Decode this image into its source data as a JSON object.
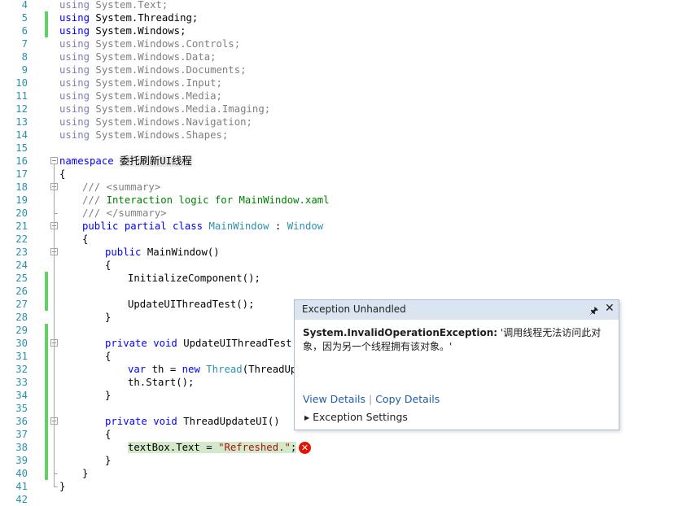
{
  "editor": {
    "lines": [
      {
        "no": "4",
        "changed": false,
        "fold": "",
        "indent": 0,
        "tokens": [
          {
            "t": "using",
            "c": "kwd"
          },
          {
            "t": " System.Text;",
            "c": "txd"
          }
        ]
      },
      {
        "no": "5",
        "changed": true,
        "fold": "",
        "indent": 0,
        "tokens": [
          {
            "t": "using",
            "c": "kw"
          },
          {
            "t": " System.Threading;",
            "c": "tx"
          }
        ]
      },
      {
        "no": "6",
        "changed": true,
        "fold": "",
        "indent": 0,
        "tokens": [
          {
            "t": "using",
            "c": "kw"
          },
          {
            "t": " System.Windows;",
            "c": "tx"
          }
        ]
      },
      {
        "no": "7",
        "changed": false,
        "fold": "",
        "indent": 0,
        "tokens": [
          {
            "t": "using",
            "c": "kwd"
          },
          {
            "t": " System.Windows.Controls;",
            "c": "txd"
          }
        ]
      },
      {
        "no": "8",
        "changed": false,
        "fold": "",
        "indent": 0,
        "tokens": [
          {
            "t": "using",
            "c": "kwd"
          },
          {
            "t": " System.Windows.Data;",
            "c": "txd"
          }
        ]
      },
      {
        "no": "9",
        "changed": false,
        "fold": "",
        "indent": 0,
        "tokens": [
          {
            "t": "using",
            "c": "kwd"
          },
          {
            "t": " System.Windows.Documents;",
            "c": "txd"
          }
        ]
      },
      {
        "no": "10",
        "changed": false,
        "fold": "",
        "indent": 0,
        "tokens": [
          {
            "t": "using",
            "c": "kwd"
          },
          {
            "t": " System.Windows.Input;",
            "c": "txd"
          }
        ]
      },
      {
        "no": "11",
        "changed": false,
        "fold": "",
        "indent": 0,
        "tokens": [
          {
            "t": "using",
            "c": "kwd"
          },
          {
            "t": " System.Windows.Media;",
            "c": "txd"
          }
        ]
      },
      {
        "no": "12",
        "changed": false,
        "fold": "",
        "indent": 0,
        "tokens": [
          {
            "t": "using",
            "c": "kwd"
          },
          {
            "t": " System.Windows.Media.Imaging;",
            "c": "txd"
          }
        ]
      },
      {
        "no": "13",
        "changed": false,
        "fold": "",
        "indent": 0,
        "tokens": [
          {
            "t": "using",
            "c": "kwd"
          },
          {
            "t": " System.Windows.Navigation;",
            "c": "txd"
          }
        ]
      },
      {
        "no": "14",
        "changed": false,
        "fold": "",
        "indent": 0,
        "tokens": [
          {
            "t": "using",
            "c": "kwd"
          },
          {
            "t": " System.Windows.Shapes;",
            "c": "txd"
          }
        ]
      },
      {
        "no": "15",
        "changed": false,
        "fold": "",
        "indent": 0,
        "tokens": []
      },
      {
        "no": "16",
        "changed": false,
        "fold": "minus",
        "indent": 0,
        "tokens": [
          {
            "t": "namespace",
            "c": "kw"
          },
          {
            "t": " ",
            "c": "tx"
          },
          {
            "t": "委托刷新UI线程",
            "c": "tx hl-ns"
          }
        ]
      },
      {
        "no": "17",
        "changed": false,
        "fold": "",
        "indent": 0,
        "tokens": [
          {
            "t": "{",
            "c": "tx"
          }
        ]
      },
      {
        "no": "18",
        "changed": false,
        "fold": "minus",
        "indent": 1,
        "tokens": [
          {
            "t": "/// <summary>",
            "c": "cmg"
          }
        ]
      },
      {
        "no": "19",
        "changed": false,
        "fold": "",
        "indent": 1,
        "tokens": [
          {
            "t": "/// ",
            "c": "cmg"
          },
          {
            "t": "Interaction logic for MainWindow.xaml",
            "c": "cm"
          }
        ]
      },
      {
        "no": "20",
        "changed": false,
        "fold": "",
        "indent": 1,
        "tokens": [
          {
            "t": "/// </summary>",
            "c": "cmg"
          }
        ]
      },
      {
        "no": "21",
        "changed": false,
        "fold": "minus",
        "indent": 1,
        "tokens": [
          {
            "t": "public partial class ",
            "c": "kw"
          },
          {
            "t": "MainWindow",
            "c": "ty"
          },
          {
            "t": " : ",
            "c": "tx"
          },
          {
            "t": "Window",
            "c": "ty"
          }
        ]
      },
      {
        "no": "22",
        "changed": false,
        "fold": "",
        "indent": 1,
        "tokens": [
          {
            "t": "{",
            "c": "tx"
          }
        ]
      },
      {
        "no": "23",
        "changed": false,
        "fold": "minus",
        "indent": 2,
        "tokens": [
          {
            "t": "public",
            "c": "kw"
          },
          {
            "t": " MainWindow()",
            "c": "tx"
          }
        ]
      },
      {
        "no": "24",
        "changed": false,
        "fold": "",
        "indent": 2,
        "tokens": [
          {
            "t": "{",
            "c": "tx"
          }
        ]
      },
      {
        "no": "25",
        "changed": true,
        "fold": "",
        "indent": 3,
        "tokens": [
          {
            "t": "InitializeComponent();",
            "c": "tx"
          }
        ]
      },
      {
        "no": "26",
        "changed": true,
        "fold": "",
        "indent": 3,
        "tokens": []
      },
      {
        "no": "27",
        "changed": true,
        "fold": "",
        "indent": 3,
        "tokens": [
          {
            "t": "UpdateUIThreadTest();",
            "c": "tx"
          }
        ]
      },
      {
        "no": "28",
        "changed": false,
        "fold": "",
        "indent": 2,
        "tokens": [
          {
            "t": "}",
            "c": "tx"
          }
        ]
      },
      {
        "no": "29",
        "changed": true,
        "fold": "",
        "indent": 2,
        "tokens": []
      },
      {
        "no": "30",
        "changed": true,
        "fold": "minus",
        "indent": 2,
        "tokens": [
          {
            "t": "private void",
            "c": "kw"
          },
          {
            "t": " UpdateUIThreadTest()",
            "c": "tx"
          }
        ]
      },
      {
        "no": "31",
        "changed": true,
        "fold": "",
        "indent": 2,
        "tokens": [
          {
            "t": "{",
            "c": "tx"
          }
        ]
      },
      {
        "no": "32",
        "changed": true,
        "fold": "",
        "indent": 3,
        "tokens": [
          {
            "t": "var",
            "c": "kw"
          },
          {
            "t": " th = ",
            "c": "tx"
          },
          {
            "t": "new",
            "c": "kw"
          },
          {
            "t": " ",
            "c": "tx"
          },
          {
            "t": "Thread",
            "c": "ty"
          },
          {
            "t": "(ThreadUpd",
            "c": "tx"
          }
        ]
      },
      {
        "no": "33",
        "changed": true,
        "fold": "",
        "indent": 3,
        "tokens": [
          {
            "t": "th.Start();",
            "c": "tx"
          }
        ]
      },
      {
        "no": "34",
        "changed": true,
        "fold": "",
        "indent": 2,
        "tokens": [
          {
            "t": "}",
            "c": "tx"
          }
        ]
      },
      {
        "no": "35",
        "changed": true,
        "fold": "",
        "indent": 2,
        "tokens": []
      },
      {
        "no": "36",
        "changed": true,
        "fold": "minus",
        "indent": 2,
        "tokens": [
          {
            "t": "private void",
            "c": "kw"
          },
          {
            "t": " ThreadUpdateUI()",
            "c": "tx"
          }
        ]
      },
      {
        "no": "37",
        "changed": true,
        "fold": "",
        "indent": 2,
        "tokens": [
          {
            "t": "{",
            "c": "tx"
          }
        ]
      },
      {
        "no": "38",
        "changed": true,
        "fold": "",
        "indent": 3,
        "tokens": [
          {
            "t": "textBox.Text = ",
            "c": "tx hl-err"
          },
          {
            "t": "\"Refreshed.\"",
            "c": "st hl-err"
          },
          {
            "t": ";",
            "c": "tx hl-err"
          }
        ]
      },
      {
        "no": "39",
        "changed": true,
        "fold": "",
        "indent": 2,
        "tokens": [
          {
            "t": "}",
            "c": "tx"
          }
        ]
      },
      {
        "no": "40",
        "changed": true,
        "fold": "",
        "indent": 1,
        "tokens": [
          {
            "t": "}",
            "c": "tx"
          }
        ]
      },
      {
        "no": "41",
        "changed": false,
        "fold": "",
        "indent": 0,
        "tokens": [
          {
            "t": "}",
            "c": "tx"
          }
        ]
      },
      {
        "no": "42",
        "changed": false,
        "fold": "",
        "indent": 0,
        "tokens": []
      }
    ]
  },
  "exception_popup": {
    "title": "Exception Unhandled",
    "pin_icon": "pin-icon",
    "close_icon": "close-icon",
    "exception_type": "System.InvalidOperationException:",
    "message": " '调用线程无法访问此对象，因为另一个线程拥有该对象。'",
    "view_details": "View Details",
    "copy_details": "Copy Details",
    "exception_settings": "Exception Settings"
  },
  "error_glyph": {
    "icon": "error-icon",
    "symbol": "✕",
    "color": "#e51400"
  }
}
